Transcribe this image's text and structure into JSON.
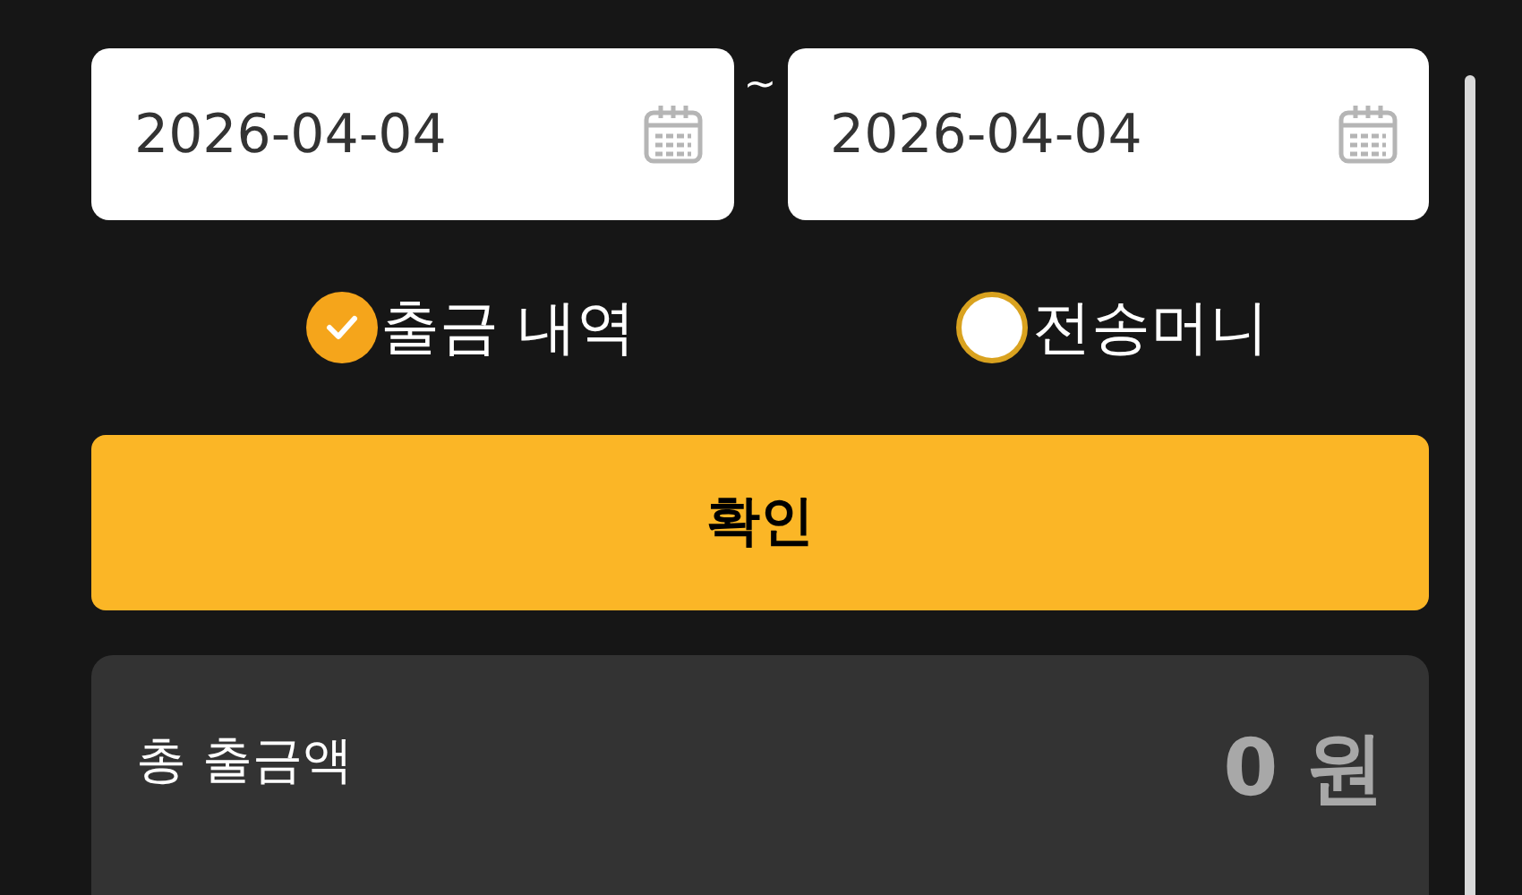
{
  "date_range": {
    "start": "2026-04-04",
    "separator": "~",
    "end": "2026-04-04"
  },
  "options": [
    {
      "label": "출금 내역",
      "selected": true
    },
    {
      "label": "전송머니",
      "selected": false
    }
  ],
  "confirm_button": "확인",
  "summary": {
    "label": "총 출금액",
    "amount": "0 원"
  }
}
